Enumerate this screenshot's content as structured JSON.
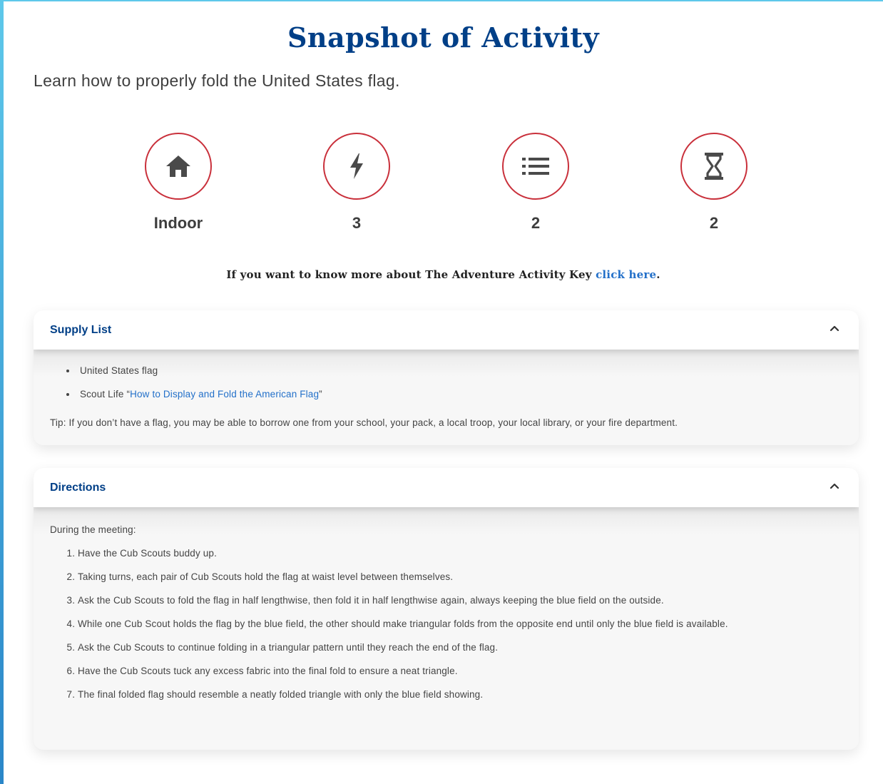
{
  "page": {
    "title": "Snapshot of Activity",
    "subtitle": "Learn how to properly fold the United States flag."
  },
  "activity_key": [
    {
      "icon": "home-icon",
      "value": "Indoor"
    },
    {
      "icon": "lightning-bolt-icon",
      "value": "3"
    },
    {
      "icon": "list-icon",
      "value": "2"
    },
    {
      "icon": "hourglass-icon",
      "value": "2"
    }
  ],
  "more_info": {
    "text": "If you want to know more about The Adventure Activity Key",
    "link_text": "click here",
    "suffix": "."
  },
  "supply_list": {
    "title": "Supply List",
    "items": [
      {
        "text": "United States flag"
      },
      {
        "prefix": "Scout Life “",
        "link_text": "How to Display and Fold the American Flag",
        "suffix": "”"
      }
    ],
    "tip": "Tip: If you don’t have a flag, you may be able to borrow one from your school, your pack, a local troop, your local library, or your fire department."
  },
  "directions": {
    "title": "Directions",
    "intro": "During the meeting:",
    "steps": [
      "Have the Cub Scouts buddy up.",
      "Taking turns, each pair of Cub Scouts hold the flag at waist level between themselves.",
      "Ask the Cub Scouts to fold the flag in half lengthwise, then fold it in half lengthwise again, always keeping the blue field on the outside.",
      "While one Cub Scout holds the flag by the blue field, the other should make triangular folds from the opposite end until only the blue field is available.",
      "Ask the Cub Scouts to continue folding in a triangular pattern until they reach the end of the flag.",
      "Have the Cub Scouts tuck any excess fabric into the final fold to ensure a neat triangle.",
      "The final folded flag should resemble a neatly folded triangle with only the blue field showing."
    ]
  },
  "colors": {
    "heading_blue": "#003f87",
    "link_blue": "#2370c9",
    "circle_red": "#c9303b",
    "icon_gray": "#4a4a4a"
  }
}
